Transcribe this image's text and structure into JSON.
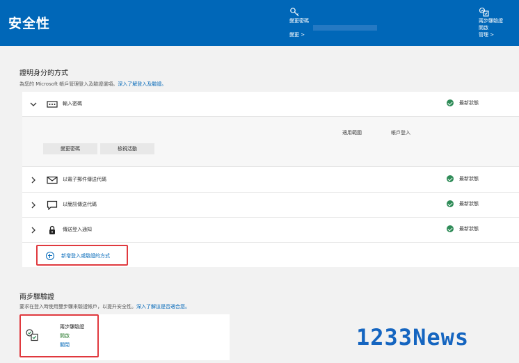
{
  "header": {
    "title": "安全性",
    "change_password": {
      "label": "變更密碼",
      "link": "變更 >"
    },
    "two_step": {
      "label": "兩步驟驗證",
      "status": "開啟",
      "link": "管理 >"
    }
  },
  "identity": {
    "title": "證明身分的方式",
    "subtitle": "為您的 Microsoft 帳戶管理登入及驗證選項。",
    "subtitle_link": "深入了解登入及驗證。",
    "methods": [
      {
        "label": "輸入密碼",
        "status": "最新狀態",
        "icon": "password-dots-icon",
        "expanded": true
      },
      {
        "label": "以電子郵件傳送代碼",
        "status": "最新狀態",
        "icon": "envelope-icon",
        "expanded": false
      },
      {
        "label": "以簡訊傳送代碼",
        "status": "最新狀態",
        "icon": "chat-bubble-icon",
        "expanded": false
      },
      {
        "label": "傳送登入通知",
        "status": "最新狀態",
        "icon": "lock-icon",
        "expanded": false
      }
    ],
    "password_details": {
      "col_scope": "適用範圍",
      "col_account": "帳戶登入",
      "change_button": "變更密碼",
      "activity_button": "檢視活動"
    },
    "add_method": "新增登入或驗證的方式"
  },
  "two_step_section": {
    "title": "兩步驟驗證",
    "subtitle": "要求在登入時使用雙步驟來驗證帳戶，以提升安全性。",
    "subtitle_link": "深入了解這是否適合您。",
    "card_title": "兩步驟驗證",
    "card_status": "開啟",
    "card_action": "關閉"
  },
  "watermark": "1233News",
  "colors": {
    "accent": "#0067b8",
    "status_ok": "#2e8b57",
    "highlight": "#e0393e"
  }
}
